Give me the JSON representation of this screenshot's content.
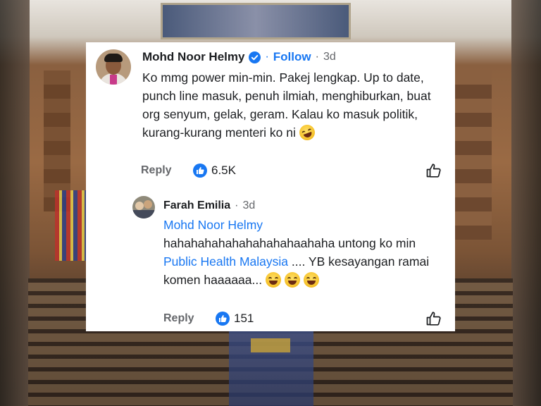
{
  "comment": {
    "author": "Mohd Noor Helmy",
    "follow_label": "Follow",
    "separator": "·",
    "time": "3d",
    "text": "Ko mmg power min-min. Pakej lengkap. Up to date, punch line masuk, penuh ilmiah, menghiburkan, buat org senyum, gelak, geram. Kalau ko masuk politik, kurang-kurang menteri ko ni",
    "emoji": "rolling-on-floor-laughing-emoji",
    "reply_label": "Reply",
    "reaction_count": "6.5K"
  },
  "reply": {
    "author": "Farah Emilia",
    "separator": "·",
    "time": "3d",
    "mention_1": "Mohd Noor Helmy",
    "text_part_1": "hahahahahahahahahahaahaha untong ko min",
    "mention_2": "Public Health Malaysia",
    "text_part_2": ".... YB kesayangan ramai komen haaaaaa...",
    "emojis": [
      "laughing-emoji",
      "laughing-emoji",
      "laughing-emoji"
    ],
    "reply_label": "Reply",
    "reaction_count": "151"
  },
  "colors": {
    "accent": "#1877f2",
    "text": "#1c1e21",
    "muted": "#65676b"
  }
}
